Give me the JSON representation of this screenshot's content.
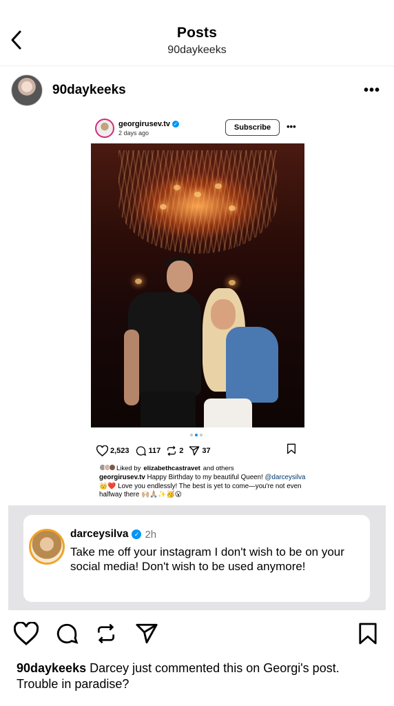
{
  "nav": {
    "title": "Posts",
    "subtitle": "90daykeeks"
  },
  "post": {
    "username": "90daykeeks",
    "more": "•••"
  },
  "embed": {
    "username": "georgirusev.tv",
    "time": "2 days ago",
    "subscribe_label": "Subscribe",
    "more": "•••",
    "likes": "2,523",
    "comments": "117",
    "reposts": "2",
    "shares": "37",
    "liked_prefix": "Liked by",
    "liked_user": "elizabethcastravet",
    "liked_suffix": "and others",
    "caption_user": "georgirusev.tv",
    "caption_line1": "Happy Birthday to my beautiful Queen!",
    "mention": "@darceysilva",
    "caption_emoji1": "👑❤️",
    "caption_line2": "Love you endlessly! The best is yet to come—you're not even halfway there",
    "caption_emoji2": "🙌🏼🙏🏼✨🥳😮"
  },
  "comment": {
    "username": "darceysilva",
    "time": "2h",
    "text": "Take me off your instagram I don't wish to be on your social media! Don't wish to be used anymore!"
  },
  "caption": {
    "username": "90daykeeks",
    "text": "Darcey just commented this on Georgi's post. Trouble in paradise?"
  },
  "colors": {
    "verified": "#0095f6",
    "mention": "#00376b",
    "band": "#e4e4e6"
  }
}
